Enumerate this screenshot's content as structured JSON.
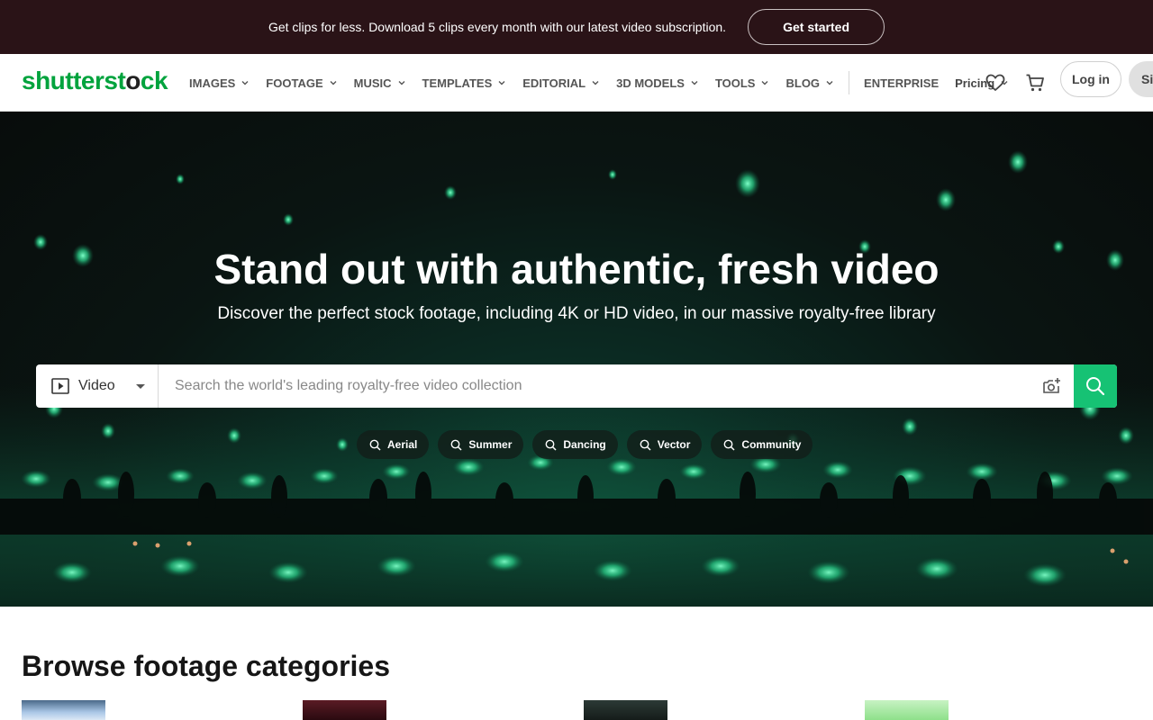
{
  "promo": {
    "text": "Get clips for less. Download 5 clips every month with our latest video subscription.",
    "button_label": "Get started"
  },
  "nav": {
    "logo_prefix": "shutterst",
    "logo_o": "o",
    "logo_suffix": "ck",
    "items": [
      {
        "label": "IMAGES"
      },
      {
        "label": "FOOTAGE"
      },
      {
        "label": "MUSIC"
      },
      {
        "label": "TEMPLATES"
      },
      {
        "label": "EDITORIAL"
      },
      {
        "label": "3D MODELS"
      },
      {
        "label": "TOOLS"
      },
      {
        "label": "BLOG"
      }
    ],
    "enterprise": "ENTERPRISE",
    "pricing": "Pricing",
    "login": "Log in",
    "signup": "Si"
  },
  "hero": {
    "title": "Stand out with authentic, fresh video",
    "subtitle": "Discover the perfect stock footage, including 4K or HD video, in our massive royalty-free library",
    "search": {
      "type_label": "Video",
      "placeholder": "Search the world's leading royalty-free video collection"
    },
    "chips": [
      "Aerial",
      "Summer",
      "Dancing",
      "Vector",
      "Community"
    ]
  },
  "browse": {
    "title": "Browse footage categories"
  },
  "colors": {
    "brand_green": "#01a33d",
    "search_button": "#16c274",
    "promo_bg": "#2a1317"
  }
}
